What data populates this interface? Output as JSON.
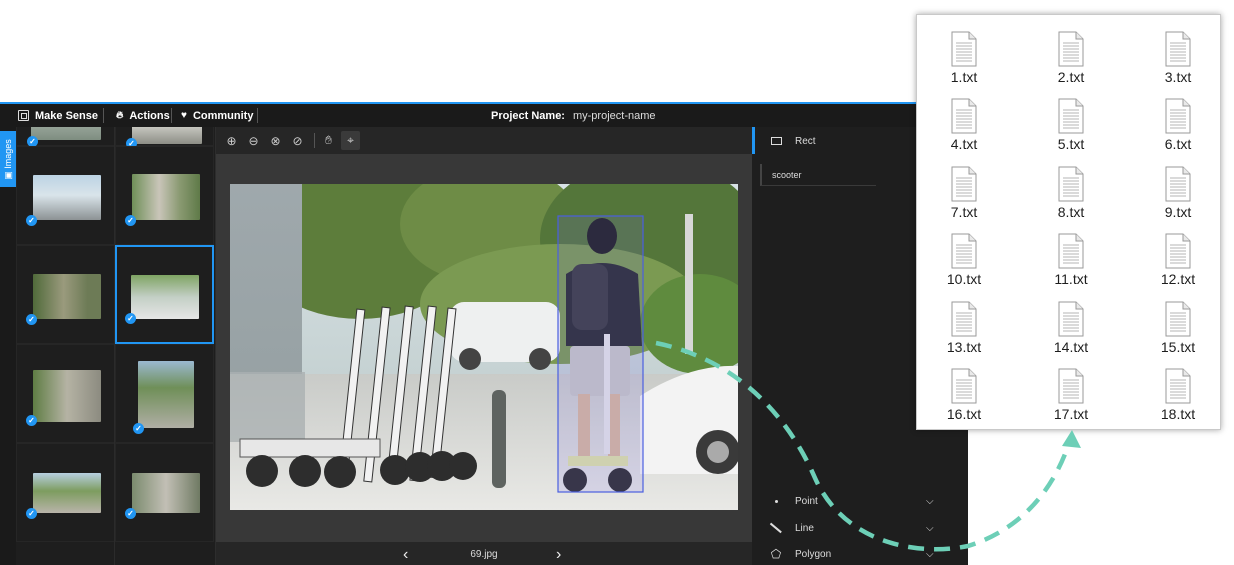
{
  "app": {
    "logo_text": "Make Sense",
    "menu": [
      {
        "label": "Actions",
        "icon": "fire-icon"
      },
      {
        "label": "Community",
        "icon": "heart-icon"
      }
    ],
    "project_label": "Project Name:",
    "project_name": "my-project-name",
    "accent_color": "#2196f3"
  },
  "images_tab": {
    "label": "Images"
  },
  "editor": {
    "toolbar": [
      "zoom-in-icon",
      "zoom-out-icon",
      "zoom-fit-icon",
      "zoom-reset-icon",
      "hand-icon",
      "crosshair-icon"
    ],
    "current_file": "69.jpg",
    "prev_label": "‹",
    "next_label": "›"
  },
  "right_panel": {
    "active_tool": "Rect",
    "label_name": "scooter",
    "tools": [
      {
        "name": "Point",
        "icon": "point-icon"
      },
      {
        "name": "Line",
        "icon": "line-icon"
      },
      {
        "name": "Polygon",
        "icon": "polygon-icon"
      }
    ]
  },
  "files": [
    "1.txt",
    "2.txt",
    "3.txt",
    "4.txt",
    "5.txt",
    "6.txt",
    "7.txt",
    "8.txt",
    "9.txt",
    "10.txt",
    "11.txt",
    "12.txt",
    "13.txt",
    "14.txt",
    "15.txt",
    "16.txt",
    "17.txt",
    "18.txt"
  ],
  "arrow_color": "#6dcfb7"
}
